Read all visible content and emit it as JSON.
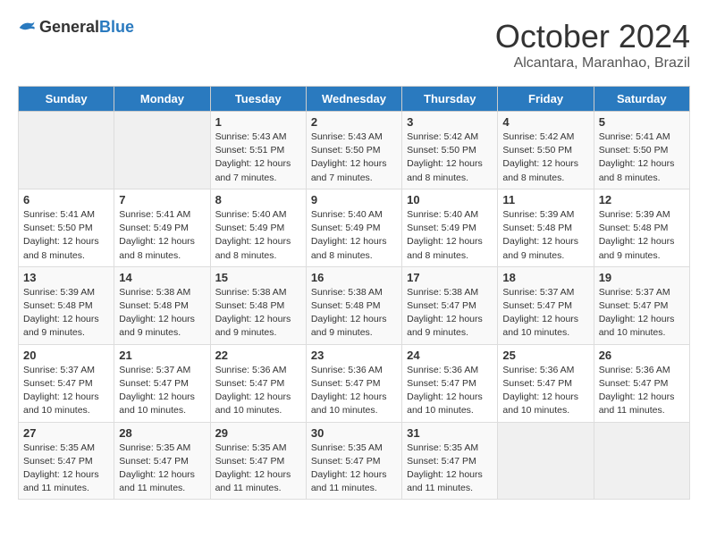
{
  "logo": {
    "general": "General",
    "blue": "Blue"
  },
  "title": {
    "month": "October 2024",
    "location": "Alcantara, Maranhao, Brazil"
  },
  "headers": [
    "Sunday",
    "Monday",
    "Tuesday",
    "Wednesday",
    "Thursday",
    "Friday",
    "Saturday"
  ],
  "weeks": [
    [
      {
        "day": "",
        "sunrise": "",
        "sunset": "",
        "daylight": ""
      },
      {
        "day": "",
        "sunrise": "",
        "sunset": "",
        "daylight": ""
      },
      {
        "day": "1",
        "sunrise": "Sunrise: 5:43 AM",
        "sunset": "Sunset: 5:51 PM",
        "daylight": "Daylight: 12 hours and 7 minutes."
      },
      {
        "day": "2",
        "sunrise": "Sunrise: 5:43 AM",
        "sunset": "Sunset: 5:50 PM",
        "daylight": "Daylight: 12 hours and 7 minutes."
      },
      {
        "day": "3",
        "sunrise": "Sunrise: 5:42 AM",
        "sunset": "Sunset: 5:50 PM",
        "daylight": "Daylight: 12 hours and 8 minutes."
      },
      {
        "day": "4",
        "sunrise": "Sunrise: 5:42 AM",
        "sunset": "Sunset: 5:50 PM",
        "daylight": "Daylight: 12 hours and 8 minutes."
      },
      {
        "day": "5",
        "sunrise": "Sunrise: 5:41 AM",
        "sunset": "Sunset: 5:50 PM",
        "daylight": "Daylight: 12 hours and 8 minutes."
      }
    ],
    [
      {
        "day": "6",
        "sunrise": "Sunrise: 5:41 AM",
        "sunset": "Sunset: 5:50 PM",
        "daylight": "Daylight: 12 hours and 8 minutes."
      },
      {
        "day": "7",
        "sunrise": "Sunrise: 5:41 AM",
        "sunset": "Sunset: 5:49 PM",
        "daylight": "Daylight: 12 hours and 8 minutes."
      },
      {
        "day": "8",
        "sunrise": "Sunrise: 5:40 AM",
        "sunset": "Sunset: 5:49 PM",
        "daylight": "Daylight: 12 hours and 8 minutes."
      },
      {
        "day": "9",
        "sunrise": "Sunrise: 5:40 AM",
        "sunset": "Sunset: 5:49 PM",
        "daylight": "Daylight: 12 hours and 8 minutes."
      },
      {
        "day": "10",
        "sunrise": "Sunrise: 5:40 AM",
        "sunset": "Sunset: 5:49 PM",
        "daylight": "Daylight: 12 hours and 8 minutes."
      },
      {
        "day": "11",
        "sunrise": "Sunrise: 5:39 AM",
        "sunset": "Sunset: 5:48 PM",
        "daylight": "Daylight: 12 hours and 9 minutes."
      },
      {
        "day": "12",
        "sunrise": "Sunrise: 5:39 AM",
        "sunset": "Sunset: 5:48 PM",
        "daylight": "Daylight: 12 hours and 9 minutes."
      }
    ],
    [
      {
        "day": "13",
        "sunrise": "Sunrise: 5:39 AM",
        "sunset": "Sunset: 5:48 PM",
        "daylight": "Daylight: 12 hours and 9 minutes."
      },
      {
        "day": "14",
        "sunrise": "Sunrise: 5:38 AM",
        "sunset": "Sunset: 5:48 PM",
        "daylight": "Daylight: 12 hours and 9 minutes."
      },
      {
        "day": "15",
        "sunrise": "Sunrise: 5:38 AM",
        "sunset": "Sunset: 5:48 PM",
        "daylight": "Daylight: 12 hours and 9 minutes."
      },
      {
        "day": "16",
        "sunrise": "Sunrise: 5:38 AM",
        "sunset": "Sunset: 5:48 PM",
        "daylight": "Daylight: 12 hours and 9 minutes."
      },
      {
        "day": "17",
        "sunrise": "Sunrise: 5:38 AM",
        "sunset": "Sunset: 5:47 PM",
        "daylight": "Daylight: 12 hours and 9 minutes."
      },
      {
        "day": "18",
        "sunrise": "Sunrise: 5:37 AM",
        "sunset": "Sunset: 5:47 PM",
        "daylight": "Daylight: 12 hours and 10 minutes."
      },
      {
        "day": "19",
        "sunrise": "Sunrise: 5:37 AM",
        "sunset": "Sunset: 5:47 PM",
        "daylight": "Daylight: 12 hours and 10 minutes."
      }
    ],
    [
      {
        "day": "20",
        "sunrise": "Sunrise: 5:37 AM",
        "sunset": "Sunset: 5:47 PM",
        "daylight": "Daylight: 12 hours and 10 minutes."
      },
      {
        "day": "21",
        "sunrise": "Sunrise: 5:37 AM",
        "sunset": "Sunset: 5:47 PM",
        "daylight": "Daylight: 12 hours and 10 minutes."
      },
      {
        "day": "22",
        "sunrise": "Sunrise: 5:36 AM",
        "sunset": "Sunset: 5:47 PM",
        "daylight": "Daylight: 12 hours and 10 minutes."
      },
      {
        "day": "23",
        "sunrise": "Sunrise: 5:36 AM",
        "sunset": "Sunset: 5:47 PM",
        "daylight": "Daylight: 12 hours and 10 minutes."
      },
      {
        "day": "24",
        "sunrise": "Sunrise: 5:36 AM",
        "sunset": "Sunset: 5:47 PM",
        "daylight": "Daylight: 12 hours and 10 minutes."
      },
      {
        "day": "25",
        "sunrise": "Sunrise: 5:36 AM",
        "sunset": "Sunset: 5:47 PM",
        "daylight": "Daylight: 12 hours and 10 minutes."
      },
      {
        "day": "26",
        "sunrise": "Sunrise: 5:36 AM",
        "sunset": "Sunset: 5:47 PM",
        "daylight": "Daylight: 12 hours and 11 minutes."
      }
    ],
    [
      {
        "day": "27",
        "sunrise": "Sunrise: 5:35 AM",
        "sunset": "Sunset: 5:47 PM",
        "daylight": "Daylight: 12 hours and 11 minutes."
      },
      {
        "day": "28",
        "sunrise": "Sunrise: 5:35 AM",
        "sunset": "Sunset: 5:47 PM",
        "daylight": "Daylight: 12 hours and 11 minutes."
      },
      {
        "day": "29",
        "sunrise": "Sunrise: 5:35 AM",
        "sunset": "Sunset: 5:47 PM",
        "daylight": "Daylight: 12 hours and 11 minutes."
      },
      {
        "day": "30",
        "sunrise": "Sunrise: 5:35 AM",
        "sunset": "Sunset: 5:47 PM",
        "daylight": "Daylight: 12 hours and 11 minutes."
      },
      {
        "day": "31",
        "sunrise": "Sunrise: 5:35 AM",
        "sunset": "Sunset: 5:47 PM",
        "daylight": "Daylight: 12 hours and 11 minutes."
      },
      {
        "day": "",
        "sunrise": "",
        "sunset": "",
        "daylight": ""
      },
      {
        "day": "",
        "sunrise": "",
        "sunset": "",
        "daylight": ""
      }
    ]
  ]
}
